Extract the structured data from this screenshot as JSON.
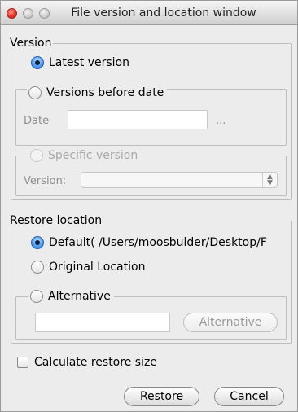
{
  "window": {
    "title": "File version and location window"
  },
  "version": {
    "legend": "Version",
    "latest_label": "Latest version",
    "before_date": {
      "legend": "Versions before date",
      "date_label": "Date",
      "date_value": "",
      "browse_label": "..."
    },
    "specific": {
      "legend": "Specific version",
      "version_label": "Version:",
      "version_value": ""
    }
  },
  "restore_location": {
    "legend": "Restore location",
    "default_label": "Default( /Users/moosbulder/Desktop/F",
    "original_label": "Original Location",
    "alternative": {
      "legend": "Alternative",
      "path_value": "",
      "button_label": "Alternative"
    }
  },
  "calculate_restore_size": {
    "label": "Calculate restore size",
    "checked": false
  },
  "actions": {
    "restore_label": "Restore",
    "cancel_label": "Cancel"
  },
  "colors": {
    "radio_selected": "#2a6fc7",
    "close_button": "#e6342a"
  }
}
